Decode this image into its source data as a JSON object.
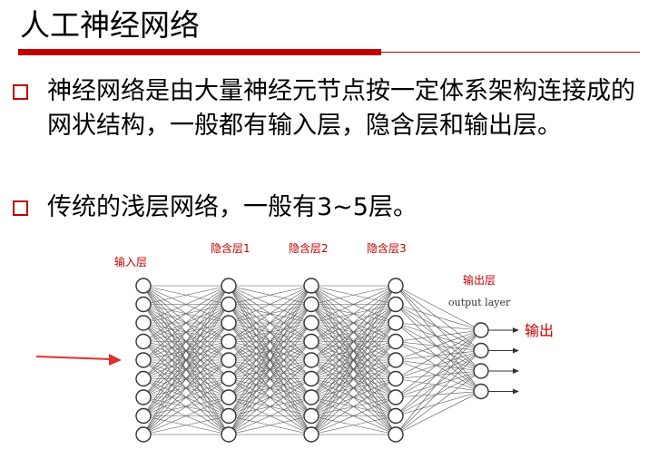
{
  "title": "人工神经网络",
  "bullets": [
    "神经网络是由大量神经元节点按一定体系架构连接成的网状结构，一般都有输入层，隐含层和输出层。",
    "传统的浅层网络，一般有3~5层。"
  ],
  "network": {
    "labels": {
      "input": "输入层",
      "hidden1": "隐含层1",
      "hidden2": "隐含层2",
      "hidden3": "隐含层3",
      "output": "输出层",
      "output_en": "output layer",
      "out_arrow": "输出"
    },
    "layer_sizes": [
      9,
      9,
      9,
      9,
      4
    ],
    "accent": "#c00000",
    "arrow_color": "#e03030"
  }
}
